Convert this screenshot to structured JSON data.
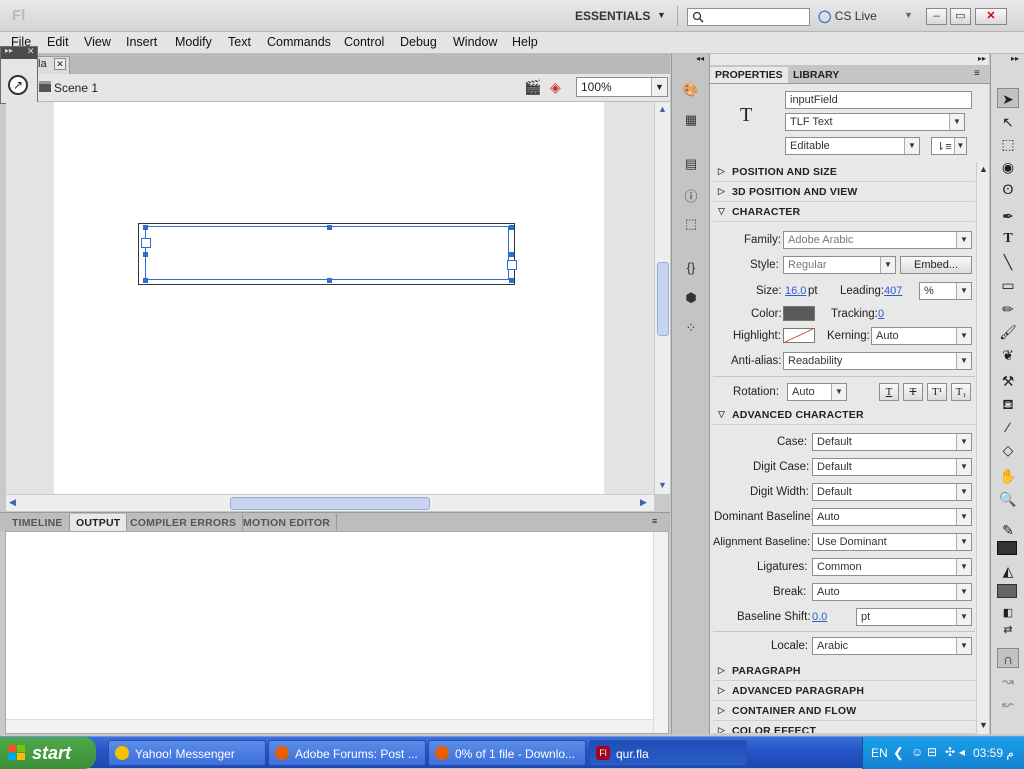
{
  "app": {
    "logo": "Fl",
    "workspace": "ESSENTIALS",
    "search_placeholder": "",
    "cs_live": "CS Live"
  },
  "menu": [
    "File",
    "Edit",
    "View",
    "Insert",
    "Modify",
    "Text",
    "Commands",
    "Control",
    "Debug",
    "Window",
    "Help"
  ],
  "document": {
    "tab_label": "fla",
    "scene": "Scene 1",
    "zoom": "100%"
  },
  "bottom_panel": {
    "tabs": [
      "TIMELINE",
      "OUTPUT",
      "COMPILER ERRORS",
      "MOTION EDITOR"
    ],
    "active_tab": "OUTPUT"
  },
  "properties": {
    "tabs": [
      "PROPERTIES",
      "LIBRARY"
    ],
    "instance_name": "inputField",
    "text_engine": "TLF Text",
    "text_type": "Editable",
    "sections": {
      "position_size": "POSITION AND SIZE",
      "position_3d": "3D POSITION AND VIEW",
      "character": "CHARACTER",
      "advanced_character": "ADVANCED CHARACTER",
      "paragraph": "PARAGRAPH",
      "advanced_paragraph": "ADVANCED PARAGRAPH",
      "container_flow": "CONTAINER AND FLOW",
      "color_effect": "COLOR EFFECT"
    },
    "character": {
      "family_label": "Family:",
      "family": "Adobe Arabic",
      "style_label": "Style:",
      "style": "Regular",
      "embed": "Embed...",
      "size_label": "Size:",
      "size": "16.0",
      "size_unit": "pt",
      "leading_label": "Leading:",
      "leading": "407",
      "leading_unit": "%",
      "color_label": "Color:",
      "color": "#5a5a5a",
      "tracking_label": "Tracking:",
      "tracking": "0",
      "highlight_label": "Highlight:",
      "kerning_label": "Kerning:",
      "kerning": "Auto",
      "antialias_label": "Anti-alias:",
      "antialias": "Readability",
      "rotation_label": "Rotation:",
      "rotation": "Auto"
    },
    "advanced": {
      "case_label": "Case:",
      "case": "Default",
      "digit_case_label": "Digit Case:",
      "digit_case": "Default",
      "digit_width_label": "Digit Width:",
      "digit_width": "Default",
      "dominant_label": "Dominant Baseline:",
      "dominant": "Auto",
      "alignment_label": "Alignment Baseline:",
      "alignment": "Use Dominant",
      "ligatures_label": "Ligatures:",
      "ligatures": "Common",
      "break_label": "Break:",
      "break": "Auto",
      "shift_label": "Baseline Shift:",
      "shift": "0.0",
      "shift_unit": "pt",
      "locale_label": "Locale:",
      "locale": "Arabic"
    }
  },
  "taskbar": {
    "start": "start",
    "tasks": [
      "Yahoo! Messenger",
      "Adobe Forums: Post ...",
      "0% of 1 file - Downlo...",
      "qur.fla"
    ],
    "lang": "EN",
    "clock": "03:59 ﻡ"
  }
}
